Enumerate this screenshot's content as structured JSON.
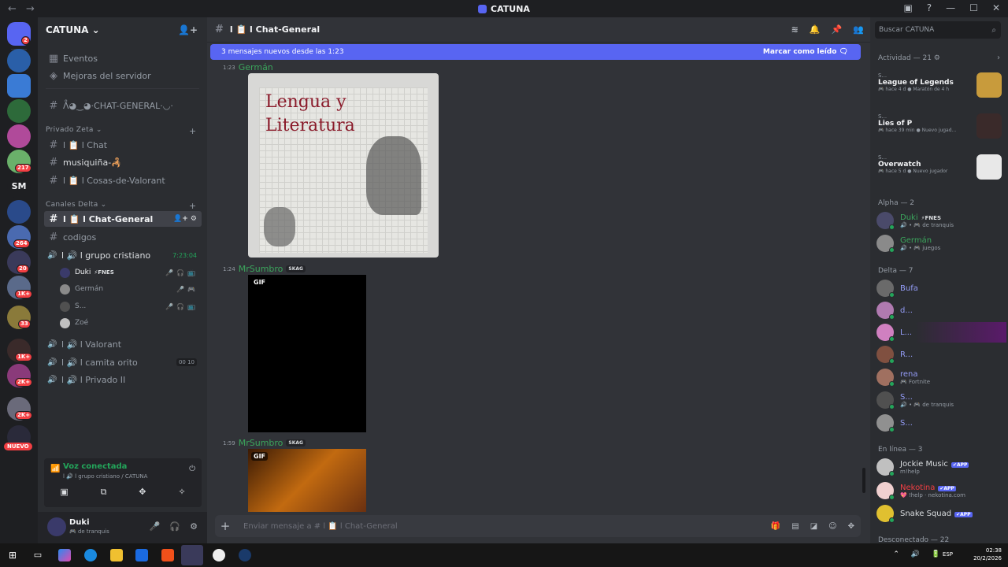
{
  "window": {
    "title": "CATUNA",
    "nav": "←  →"
  },
  "rail": {
    "badges": [
      "2",
      "217",
      "264",
      "20",
      "1K+",
      "33",
      "1K+",
      "2K+",
      "2K+"
    ],
    "sm_label": "SM",
    "new_label": "NUEVO"
  },
  "sidebar": {
    "server_name": "CATUNA ⌄",
    "items": [
      {
        "label": "Eventos"
      },
      {
        "label": "Mejoras del servidor"
      }
    ],
    "channels_top": [
      {
        "label": "ᐰ◕‿◕·CHAT-GENERAL·◡·"
      }
    ],
    "categories": {
      "privado_zeta": "Privado Zeta ⌄",
      "canales_delta": "Canales Delta ⌄"
    },
    "privado_channels": [
      {
        "label": "l 📋 l Chat"
      },
      {
        "label": "musiquiña-🦂"
      },
      {
        "label": "l 📋 l Cosas-de-Valorant"
      }
    ],
    "delta_channels": [
      {
        "label": "l 📋 l Chat-General"
      },
      {
        "label": "codigos"
      }
    ],
    "voice_active": {
      "label": "l 🔊 l grupo cristiano",
      "time": "7:23:04"
    },
    "voice_users": [
      {
        "name": "Duki",
        "tag": "⚡FNES",
        "color": "#f2f3f5"
      },
      {
        "name": "Germán",
        "tag": "",
        "color": "#949ba4"
      },
      {
        "name": "S...",
        "tag": "",
        "color": "#949ba4"
      },
      {
        "name": "Zoé",
        "tag": "",
        "color": "#949ba4"
      }
    ],
    "voice_channels": [
      {
        "label": "l 🔊 l Valorant",
        "count": ""
      },
      {
        "label": "l 🔊 l camita orito",
        "count": "00  10"
      },
      {
        "label": "l 🔊 l Privado II",
        "count": ""
      }
    ],
    "voice_status": {
      "title": "Voz conectada",
      "subtitle": "l 🔊 l grupo cristiano / CATUNA"
    },
    "user": {
      "name": "Duki",
      "status": "🎮 de tranquis"
    }
  },
  "chat": {
    "channel": "l 📋 l Chat-General",
    "new_messages": "3 mensajes nuevos desde las 1:23",
    "mark_read": "Marcar como leído",
    "messages": [
      {
        "time": "1:23",
        "author": "Germán",
        "color": "#3ba55c",
        "tag": "",
        "drawing_title": "Lengua y Literatura"
      },
      {
        "time": "1:24",
        "author": "MrSumbro",
        "color": "#3ba55c",
        "tag": "SKAG",
        "gif": "GIF"
      },
      {
        "time": "1:59",
        "author": "MrSumbro",
        "color": "#3ba55c",
        "tag": "SKAG",
        "gif": "GIF"
      }
    ],
    "composer_placeholder": "Enviar mensaje a #  l 📋 l Chat-General"
  },
  "members": {
    "search_placeholder": "Buscar CATUNA",
    "activity_header": "Actividad — 21 ⚙",
    "activities": [
      {
        "user": "S...",
        "game": "League of Legends",
        "meta": "🎮 hace 4 d  ●  Maratón de 4 h",
        "color": "#c89b3c"
      },
      {
        "user": "S...",
        "game": "Lies of P",
        "meta": "🎮 hace 39 min  ●  Nuevo jugad...",
        "color": "#3a2a2a"
      },
      {
        "user": "S...",
        "game": "Overwatch",
        "meta": "🎮 hace 5 d  ●  Nuevo jugador",
        "color": "#e8e8e8"
      }
    ],
    "groups": [
      {
        "header": "Alpha — 2",
        "members": [
          {
            "name": "Duki",
            "tag": "⚡FNES",
            "sub": "🔊 • 🎮 de tranquis",
            "color": "#3ba55c",
            "av": "#4a4a6a"
          },
          {
            "name": "Germán",
            "tag": "",
            "sub": "🔊 • 🎮 juegos",
            "color": "#3ba55c",
            "av": "#8a8a8a"
          }
        ]
      },
      {
        "header": "Delta — 7",
        "members": [
          {
            "name": "Bufa",
            "tag": "",
            "sub": "",
            "color": "#949cf7",
            "av": "#6a6a6a"
          },
          {
            "name": "d...",
            "tag": "",
            "sub": "",
            "color": "#949cf7",
            "av": "#b07ab0"
          },
          {
            "name": "L...",
            "tag": "",
            "sub": "",
            "color": "#949cf7",
            "av": "#d080c0"
          },
          {
            "name": "R...",
            "tag": "",
            "sub": "",
            "color": "#949cf7",
            "av": "#805040"
          },
          {
            "name": "rena",
            "tag": "",
            "sub": "🎮 Fortnite",
            "color": "#949cf7",
            "av": "#a07060"
          },
          {
            "name": "S...",
            "tag": "",
            "sub": "🔊 • 🎮 de tranquis",
            "color": "#949cf7",
            "av": "#505050"
          },
          {
            "name": "S...",
            "tag": "",
            "sub": "",
            "color": "#949cf7",
            "av": "#909090"
          }
        ]
      },
      {
        "header": "En línea — 3",
        "members": [
          {
            "name": "Jockie Music",
            "tag": "✔APP",
            "sub": "m!help",
            "color": "#dbdee1",
            "av": "#c0c0c0"
          },
          {
            "name": "Nekotina",
            "tag": "✔APP",
            "sub": "💖 !help · nekotina.com",
            "color": "#f23f43",
            "av": "#f0d0d0"
          },
          {
            "name": "Snake Squad",
            "tag": "✔APP",
            "sub": "",
            "color": "#dbdee1",
            "av": "#e0c030"
          }
        ]
      }
    ],
    "offline_header": "Desconectado — 22"
  },
  "taskbar": {
    "time": "02:38",
    "date": "20/2/2026",
    "lang": "ESP"
  }
}
